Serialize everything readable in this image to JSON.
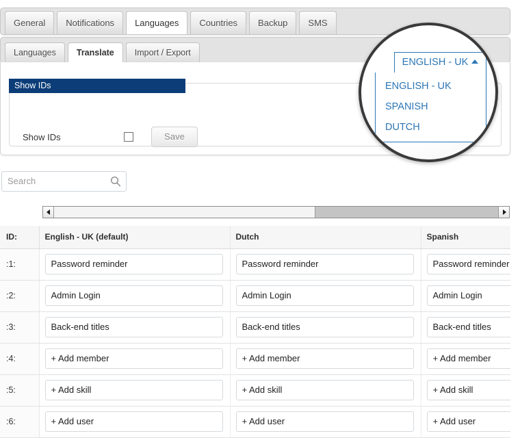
{
  "tabs_primary": [
    {
      "label": "General",
      "active": false
    },
    {
      "label": "Notifications",
      "active": false
    },
    {
      "label": "Languages",
      "active": true
    },
    {
      "label": "Countries",
      "active": false
    },
    {
      "label": "Backup",
      "active": false
    },
    {
      "label": "SMS",
      "active": false
    }
  ],
  "tabs_secondary": [
    {
      "label": "Languages",
      "active": false
    },
    {
      "label": "Translate",
      "active": true
    },
    {
      "label": "Import / Export",
      "active": false
    }
  ],
  "panel": {
    "legend": "Show IDs",
    "show_ids_label": "Show IDs",
    "save_label": "Save",
    "checkbox_checked": false
  },
  "search": {
    "placeholder": "Search",
    "value": "",
    "icon": "search-icon"
  },
  "scrollbar": {
    "left_arrow": "◀",
    "right_arrow": "▶"
  },
  "magnifier": {
    "trigger_label": "ENGLISH - UK",
    "caret": "caret-up-icon",
    "options": [
      {
        "label": "ENGLISH - UK"
      },
      {
        "label": "SPANISH"
      },
      {
        "label": "DUTCH"
      }
    ],
    "accent_color": "#2c76b5",
    "ring_color": "#3a3a3a"
  },
  "table": {
    "headers": [
      "ID:",
      "English - UK (default)",
      "Dutch",
      "Spanish"
    ],
    "rows": [
      {
        "id": ":1:",
        "en": "Password reminder",
        "nl": "Password reminder",
        "es": "Password reminder"
      },
      {
        "id": ":2:",
        "en": "Admin Login",
        "nl": "Admin Login",
        "es": "Admin Login"
      },
      {
        "id": ":3:",
        "en": "Back-end titles",
        "nl": "Back-end titles",
        "es": "Back-end titles"
      },
      {
        "id": ":4:",
        "en": "+ Add member",
        "nl": "+ Add member",
        "es": "+ Add member"
      },
      {
        "id": ":5:",
        "en": "+ Add skill",
        "nl": "+ Add skill",
        "es": "+ Add skill"
      },
      {
        "id": ":6:",
        "en": "+ Add user",
        "nl": "+ Add user",
        "es": "+ Add user"
      }
    ]
  }
}
